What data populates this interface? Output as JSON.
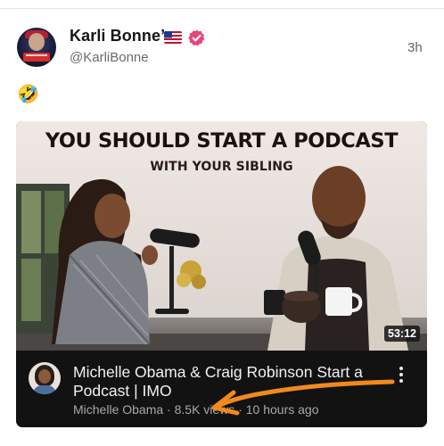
{
  "post": {
    "author_name": "Karli Bonne’",
    "handle": "@KarliBonne",
    "time_ago": "3h",
    "flag_emoji": "us-flag-icon",
    "verified": true,
    "verified_color": "#e5467a",
    "text": "🤣"
  },
  "video": {
    "thumbnail_headline": "YOU SHOULD START A PODCAST",
    "thumbnail_subhead": "WITH YOUR SIBLING",
    "duration": "53:12",
    "title": "Michelle Obama & Craig Robinson Start a Podcast | IMO",
    "channel": "Michelle Obama",
    "views": "8.5K views",
    "uploaded": "10 hours ago",
    "separator": " · ",
    "card_color": "#121212"
  },
  "annotation": {
    "arrow_color": "#f08a1d"
  }
}
